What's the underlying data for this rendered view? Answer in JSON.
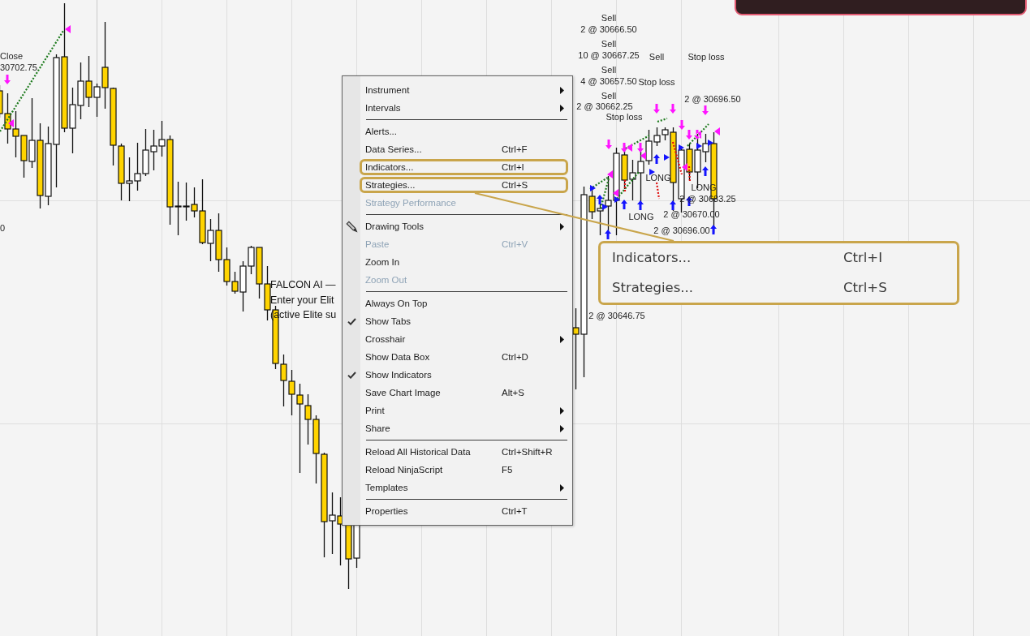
{
  "chart": {
    "trade_labels": [
      "Close",
      "30702.75",
      "0",
      "Sell",
      "2 @ 30666.50",
      "Sell",
      "10 @ 30667.25",
      "Sell",
      "4 @ 30657.50",
      "Sell",
      "2 @ 30662.25",
      "Stop loss",
      "Sell",
      "Stop loss",
      "Stop loss",
      "2 @ 30696.50",
      "LONG",
      "LONG",
      "2 @ 30683.25",
      "LONG",
      "2 @ 30670.00",
      "2 @ 30696.00",
      "2 @ 30646.75"
    ],
    "overlay_text": [
      "FALCON AI —",
      "Enter your Elit",
      "(active Elite su"
    ]
  },
  "menu": {
    "items": [
      {
        "kind": "item",
        "label": "Instrument",
        "submenu": true,
        "disabled": false,
        "checked": false,
        "has_icon": false,
        "annotated": false
      },
      {
        "kind": "item",
        "label": "Intervals",
        "submenu": true,
        "disabled": false,
        "checked": false,
        "has_icon": false,
        "annotated": false
      },
      {
        "kind": "separator"
      },
      {
        "kind": "item",
        "label": "Alerts...",
        "submenu": false,
        "disabled": false,
        "checked": false,
        "has_icon": false,
        "annotated": false
      },
      {
        "kind": "item",
        "label": "Data Series...",
        "shortcut": "Ctrl+F",
        "submenu": false,
        "disabled": false,
        "checked": false,
        "has_icon": false,
        "annotated": false
      },
      {
        "kind": "item",
        "label": "Indicators...",
        "shortcut": "Ctrl+I",
        "submenu": false,
        "disabled": false,
        "checked": false,
        "has_icon": false,
        "annotated": true
      },
      {
        "kind": "item",
        "label": "Strategies...",
        "shortcut": "Ctrl+S",
        "submenu": false,
        "disabled": false,
        "checked": false,
        "has_icon": false,
        "annotated": true
      },
      {
        "kind": "item",
        "label": "Strategy Performance",
        "submenu": false,
        "disabled": true,
        "checked": false,
        "has_icon": false,
        "annotated": false
      },
      {
        "kind": "separator"
      },
      {
        "kind": "item",
        "label": "Drawing Tools",
        "submenu": true,
        "disabled": false,
        "checked": false,
        "has_icon": true,
        "annotated": false
      },
      {
        "kind": "item",
        "label": "Paste",
        "shortcut": "Ctrl+V",
        "submenu": false,
        "disabled": true,
        "checked": false,
        "has_icon": false,
        "annotated": false
      },
      {
        "kind": "item",
        "label": "Zoom In",
        "submenu": false,
        "disabled": false,
        "checked": false,
        "has_icon": false,
        "annotated": false
      },
      {
        "kind": "item",
        "label": "Zoom Out",
        "submenu": false,
        "disabled": true,
        "checked": false,
        "has_icon": false,
        "annotated": false
      },
      {
        "kind": "separator"
      },
      {
        "kind": "item",
        "label": "Always On Top",
        "submenu": false,
        "disabled": false,
        "checked": false,
        "has_icon": false,
        "annotated": false
      },
      {
        "kind": "item",
        "label": "Show Tabs",
        "submenu": false,
        "disabled": false,
        "checked": true,
        "has_icon": false,
        "annotated": false
      },
      {
        "kind": "item",
        "label": "Crosshair",
        "submenu": true,
        "disabled": false,
        "checked": false,
        "has_icon": false,
        "annotated": false
      },
      {
        "kind": "item",
        "label": "Show Data Box",
        "shortcut": "Ctrl+D",
        "submenu": false,
        "disabled": false,
        "checked": false,
        "has_icon": false,
        "annotated": false
      },
      {
        "kind": "item",
        "label": "Show Indicators",
        "submenu": false,
        "disabled": false,
        "checked": true,
        "has_icon": false,
        "annotated": false
      },
      {
        "kind": "item",
        "label": "Save Chart Image",
        "shortcut": "Alt+S",
        "submenu": false,
        "disabled": false,
        "checked": false,
        "has_icon": false,
        "annotated": false
      },
      {
        "kind": "item",
        "label": "Print",
        "submenu": true,
        "disabled": false,
        "checked": false,
        "has_icon": false,
        "annotated": false
      },
      {
        "kind": "item",
        "label": "Share",
        "submenu": true,
        "disabled": false,
        "checked": false,
        "has_icon": false,
        "annotated": false
      },
      {
        "kind": "separator"
      },
      {
        "kind": "item",
        "label": "Reload All Historical Data",
        "shortcut": "Ctrl+Shift+R",
        "submenu": false,
        "disabled": false,
        "checked": false,
        "has_icon": false,
        "annotated": false
      },
      {
        "kind": "item",
        "label": "Reload NinjaScript",
        "shortcut": "F5",
        "submenu": false,
        "disabled": false,
        "checked": false,
        "has_icon": false,
        "annotated": false
      },
      {
        "kind": "item",
        "label": "Templates",
        "submenu": true,
        "disabled": false,
        "checked": false,
        "has_icon": false,
        "annotated": false
      },
      {
        "kind": "separator"
      },
      {
        "kind": "item",
        "label": "Properties",
        "shortcut": "Ctrl+T",
        "submenu": false,
        "disabled": false,
        "checked": false,
        "has_icon": false,
        "annotated": false
      }
    ]
  },
  "callout": {
    "rows": [
      {
        "label": "Indicators...",
        "shortcut": "Ctrl+I"
      },
      {
        "label": "Strategies...",
        "shortcut": "Ctrl+S"
      }
    ]
  }
}
